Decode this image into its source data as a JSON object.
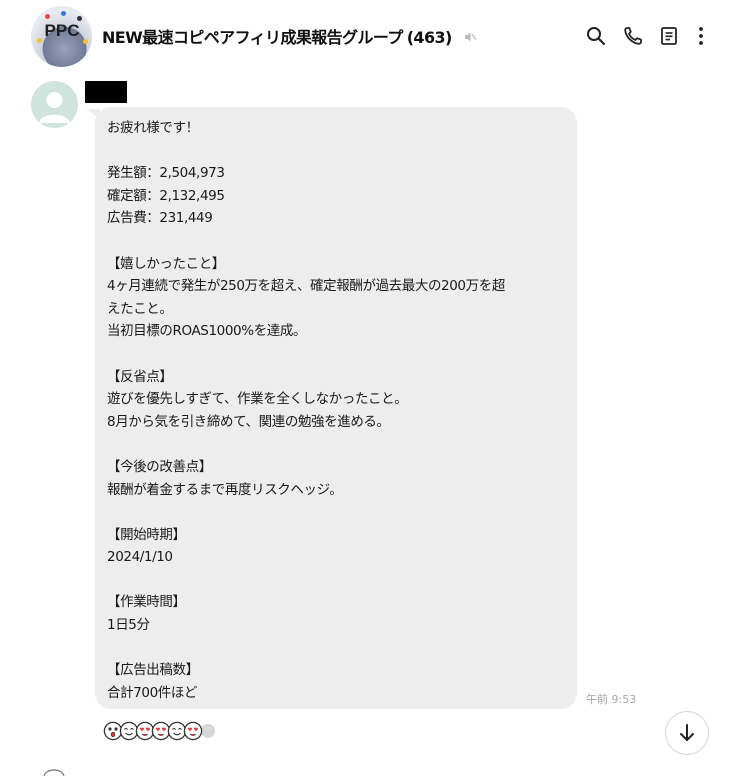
{
  "header": {
    "avatar_text": "PPC",
    "title": "NEW最速コピペアフィリ成果報告グループ",
    "member_count": "(463)"
  },
  "message": {
    "lines": [
      "お疲れ様です！",
      "",
      "発生額：2,504,973",
      "確定額：2,132,495",
      "広告費：231,449",
      "",
      "【嬉しかったこと】",
      "4ヶ月連続で発生が250万を超え、確定報酬が過去最大の200万を超",
      "えたこと。",
      "当初目標のROAS1000%を達成。",
      "",
      "【反省点】",
      "遊びを優先しすぎて、作業を全くしなかったこと。",
      "8月から気を引き締めて、関連の勉強を進める。",
      "",
      "【今後の改善点】",
      "報酬が着金するまで再度リスクヘッジ。",
      "",
      "【開始時期】",
      "2024/1/10",
      "",
      "【作業時間】",
      "1日5分",
      "",
      "【広告出稿数】",
      "合計700件ほど"
    ],
    "timestamp": "午前 9:53",
    "reactions": [
      "surprised-face",
      "smiling-face",
      "heart-eyes-face",
      "heart-eyes-face",
      "smiling-face",
      "heart-eyes-face"
    ]
  },
  "icons": {
    "mute": "speaker-muted-icon",
    "search": "search-icon",
    "call": "phone-icon",
    "notes": "notes-icon",
    "more": "more-vertical-icon",
    "scroll": "chevron-down-icon"
  },
  "colors": {
    "bubble": "#ededed",
    "timestamp": "#a6a6a6",
    "icon": "#222222"
  }
}
